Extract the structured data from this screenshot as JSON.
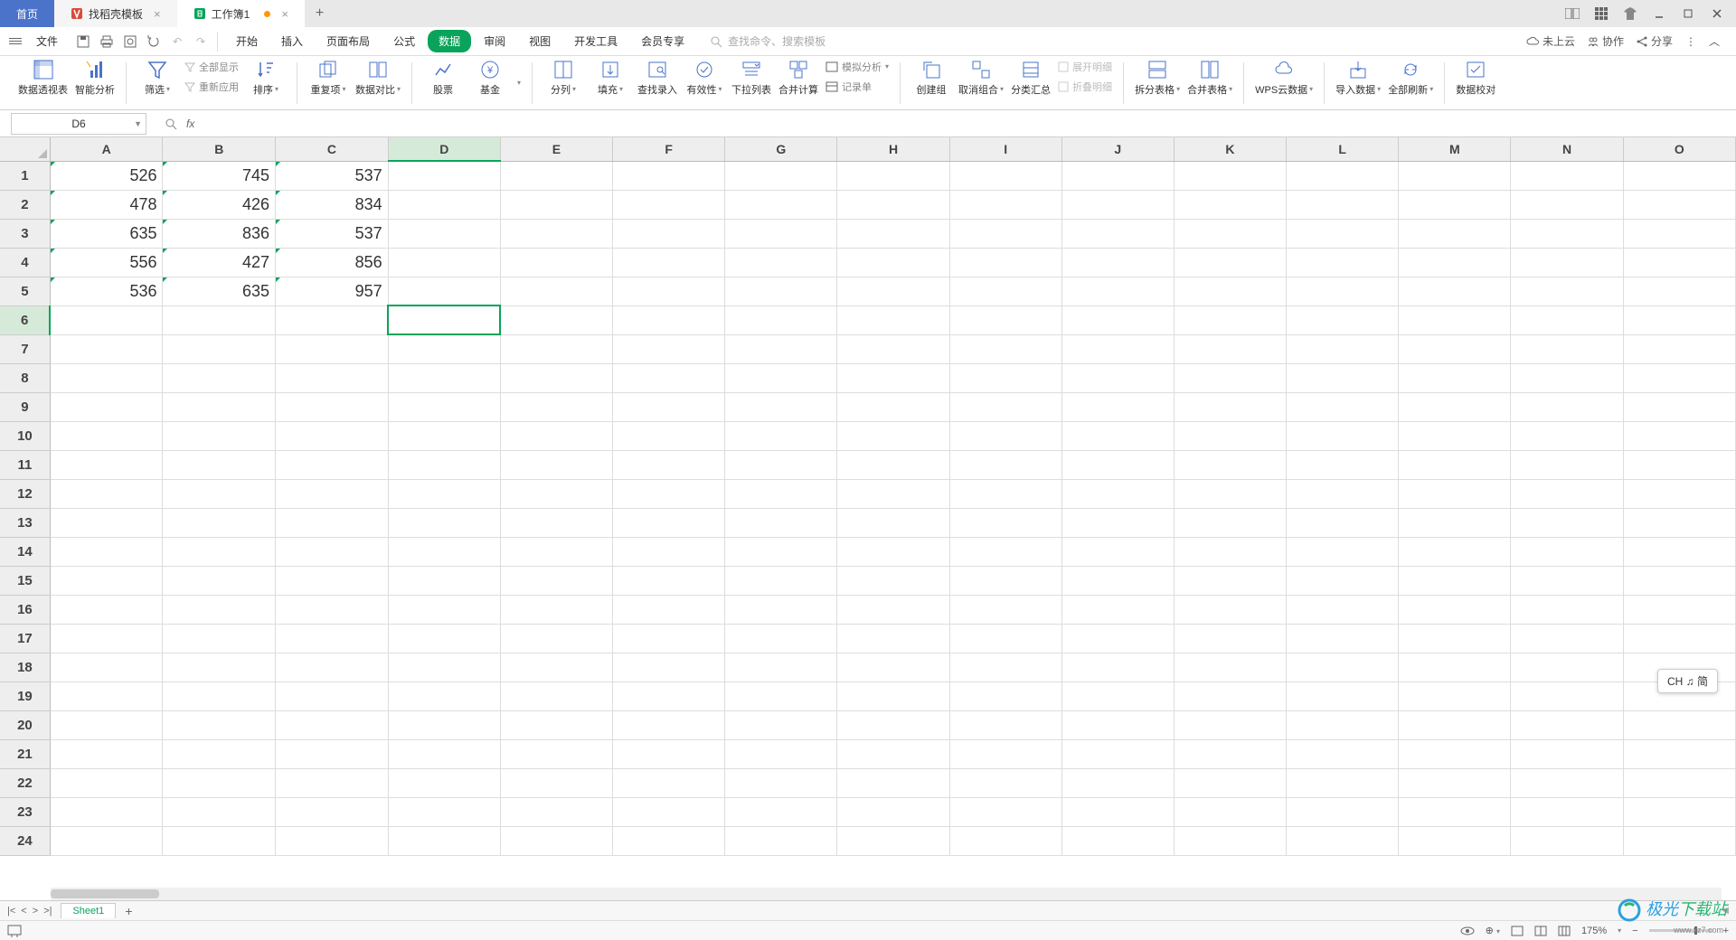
{
  "tabs": {
    "home": "首页",
    "template": "找稻壳模板",
    "workbook": "工作簿1"
  },
  "menubar": {
    "file": "文件",
    "items": [
      "开始",
      "插入",
      "页面布局",
      "公式",
      "数据",
      "审阅",
      "视图",
      "开发工具",
      "会员专享"
    ],
    "active_index": 4,
    "search_placeholder": "查找命令、搜索模板",
    "right": {
      "cloud": "未上云",
      "coop": "协作",
      "share": "分享"
    }
  },
  "ribbon": {
    "pivot": "数据透视表",
    "smart": "智能分析",
    "filter": "筛选",
    "show_all": "全部显示",
    "reapply": "重新应用",
    "sort": "排序",
    "dup": "重复项",
    "compare": "数据对比",
    "stock": "股票",
    "fund": "基金",
    "split": "分列",
    "fill": "填充",
    "lookup": "查找录入",
    "validity": "有效性",
    "dropdown": "下拉列表",
    "consolidate": "合并计算",
    "simulate": "模拟分析",
    "record": "记录单",
    "group": "创建组",
    "ungroup": "取消组合",
    "subtotal": "分类汇总",
    "expand": "展开明细",
    "collapse": "折叠明细",
    "splittab": "拆分表格",
    "mergetab": "合并表格",
    "wpscloud": "WPS云数据",
    "import": "导入数据",
    "refresh": "全部刷新",
    "validate": "数据校对"
  },
  "namebox": "D6",
  "fx_label": "fx",
  "columns": [
    "A",
    "B",
    "C",
    "D",
    "E",
    "F",
    "G",
    "H",
    "I",
    "J",
    "K",
    "L",
    "M",
    "N",
    "O"
  ],
  "row_count": 24,
  "selected": {
    "row": 6,
    "colIndex": 3
  },
  "cells": {
    "A1": "526",
    "B1": "745",
    "C1": "537",
    "A2": "478",
    "B2": "426",
    "C2": "834",
    "A3": "635",
    "B3": "836",
    "C3": "537",
    "A4": "556",
    "B4": "427",
    "C4": "856",
    "A5": "536",
    "B5": "635",
    "C5": "957"
  },
  "sheets": {
    "name": "Sheet1"
  },
  "ime": "CH ♫ 简",
  "status": {
    "zoom": "175%"
  },
  "watermark": {
    "brand1": "极光",
    "brand2": "下载站",
    "url": "www.xz7.com"
  }
}
